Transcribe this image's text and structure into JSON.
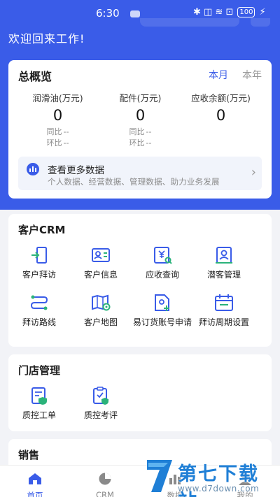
{
  "status_bar": {
    "time": "6:30",
    "icons": "✱ ◫ ≋ ⊡",
    "battery": "100"
  },
  "header": {
    "welcome": "欢迎回来工作!"
  },
  "overview": {
    "title": "总概览",
    "tabs": [
      {
        "label": "本月",
        "active": true
      },
      {
        "label": "本年",
        "active": false
      }
    ],
    "metrics": [
      {
        "label": "润滑油(万元)",
        "value": "0",
        "yoy_label": "同比",
        "yoy": "--",
        "mom_label": "环比",
        "mom": "--"
      },
      {
        "label": "配件(万元)",
        "value": "0",
        "yoy_label": "同比",
        "yoy": "--",
        "mom_label": "环比",
        "mom": "--"
      },
      {
        "label": "应收余额(万元)",
        "value": "0"
      }
    ],
    "more": {
      "title": "查看更多数据",
      "subtitle": "个人数据、经营数据、管理数据、助力业务发展",
      "icon": "bar-chart-icon"
    }
  },
  "crm": {
    "title": "客户CRM",
    "items": [
      {
        "label": "客户拜访",
        "icon": "door-exit-icon"
      },
      {
        "label": "客户信息",
        "icon": "id-card-icon"
      },
      {
        "label": "应收查询",
        "icon": "yen-search-icon"
      },
      {
        "label": "潜客管理",
        "icon": "user-manage-icon"
      },
      {
        "label": "拜访路线",
        "icon": "route-icon"
      },
      {
        "label": "客户地图",
        "icon": "map-pin-icon"
      },
      {
        "label": "易订货账号申请",
        "icon": "add-file-icon"
      },
      {
        "label": "拜访周期设置",
        "icon": "calendar-icon"
      }
    ]
  },
  "store": {
    "title": "门店管理",
    "items": [
      {
        "label": "质控工单",
        "icon": "shield-doc-icon"
      },
      {
        "label": "质控考评",
        "icon": "shield-check-icon"
      }
    ]
  },
  "sales": {
    "title": "销售"
  },
  "tabbar": {
    "items": [
      {
        "label": "首页",
        "icon": "home-icon",
        "active": true
      },
      {
        "label": "CRM",
        "icon": "pie-icon",
        "active": false
      },
      {
        "label": "数据",
        "icon": "data-icon",
        "active": false
      },
      {
        "label": "我的",
        "icon": "user-icon",
        "active": false
      }
    ]
  },
  "watermark": {
    "text": "第七下载站",
    "url": "www.d7down.com"
  },
  "colors": {
    "brand": "#3a5ce8",
    "background": "#f2f3f7",
    "icon_accent": "#2bb37a"
  }
}
